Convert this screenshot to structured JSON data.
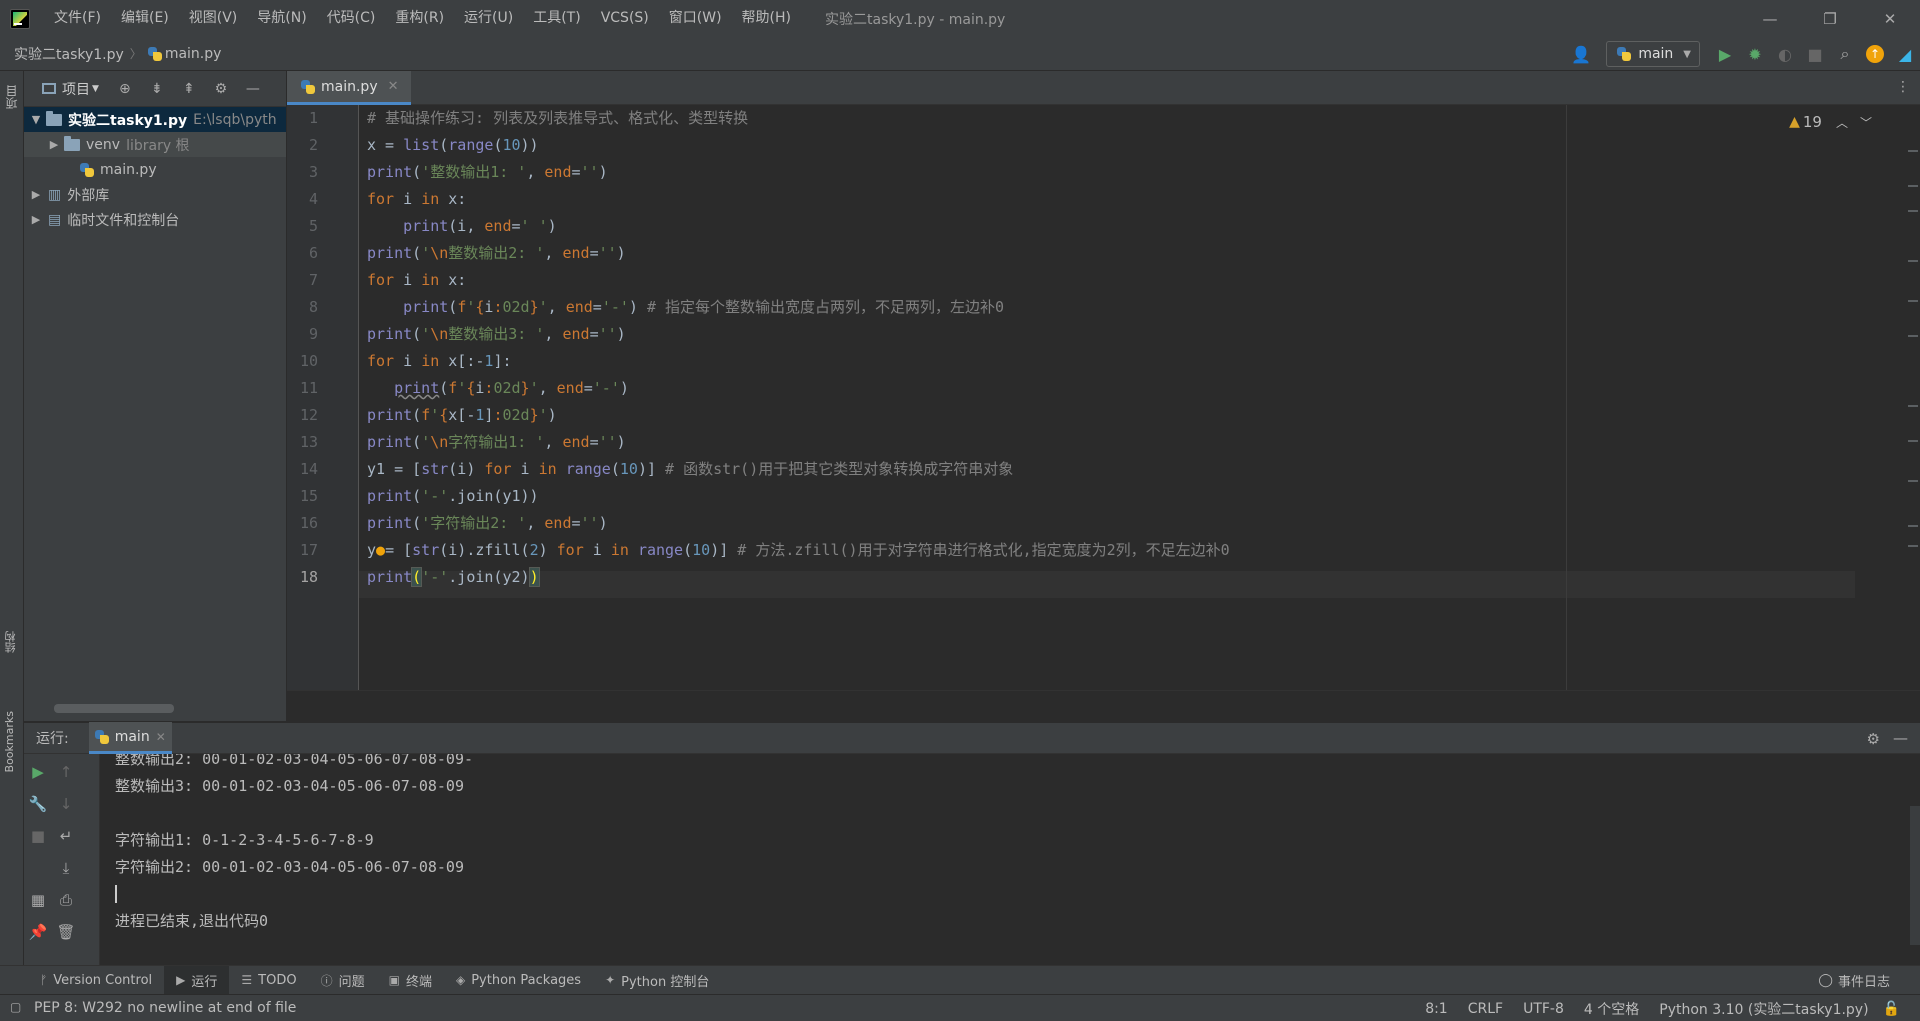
{
  "menu": {
    "items": [
      "文件(F)",
      "编辑(E)",
      "视图(V)",
      "导航(N)",
      "代码(C)",
      "重构(R)",
      "运行(U)",
      "工具(T)",
      "VCS(S)",
      "窗口(W)",
      "帮助(H)"
    ],
    "window_title": "实验二tasky1.py - main.py"
  },
  "breadcrumb": {
    "project": "实验二tasky1.py",
    "file": "main.py"
  },
  "run_config": {
    "name": "main"
  },
  "project_panel": {
    "title": "项目",
    "tree": [
      {
        "label": "实验二tasky1.py",
        "hint": "E:\\lsqb\\pyth"
      },
      {
        "label": "venv",
        "hint": "library 根"
      },
      {
        "label": "main.py",
        "hint": ""
      },
      {
        "label": "外部库",
        "hint": ""
      },
      {
        "label": "临时文件和控制台",
        "hint": ""
      }
    ]
  },
  "left_strip": {
    "project": "项目",
    "structure": "结构",
    "bookmarks": "Bookmarks"
  },
  "editor": {
    "tab": "main.py",
    "warnings": "19",
    "line_numbers": [
      "1",
      "2",
      "3",
      "4",
      "5",
      "6",
      "7",
      "8",
      "9",
      "10",
      "11",
      "12",
      "13",
      "14",
      "15",
      "16",
      "17",
      "18"
    ],
    "current_line": 18
  },
  "run_panel": {
    "label": "运行:",
    "tab": "main",
    "output": [
      "整数输出2: 00-01-02-03-04-05-06-07-08-09-",
      "整数输出3: 00-01-02-03-04-05-06-07-08-09",
      "",
      "字符输出1: 0-1-2-3-4-5-6-7-8-9",
      "字符输出2: 00-01-02-03-04-05-06-07-08-09",
      "",
      "进程已结束,退出代码0"
    ]
  },
  "bottom_tabs": [
    "Version Control",
    "运行",
    "TODO",
    "问题",
    "终端",
    "Python Packages",
    "Python 控制台"
  ],
  "event_log": "事件日志",
  "status": {
    "message": "PEP 8: W292 no newline at end of file",
    "position": "8:1",
    "line_sep": "CRLF",
    "encoding": "UTF-8",
    "indent": "4 个空格",
    "interpreter": "Python 3.10 (实验二tasky1.py)"
  },
  "colors": {
    "accent": "#4a88c7",
    "keyword": "#cc7832",
    "string": "#6a8759",
    "number": "#6897bb",
    "comment": "#808080"
  }
}
